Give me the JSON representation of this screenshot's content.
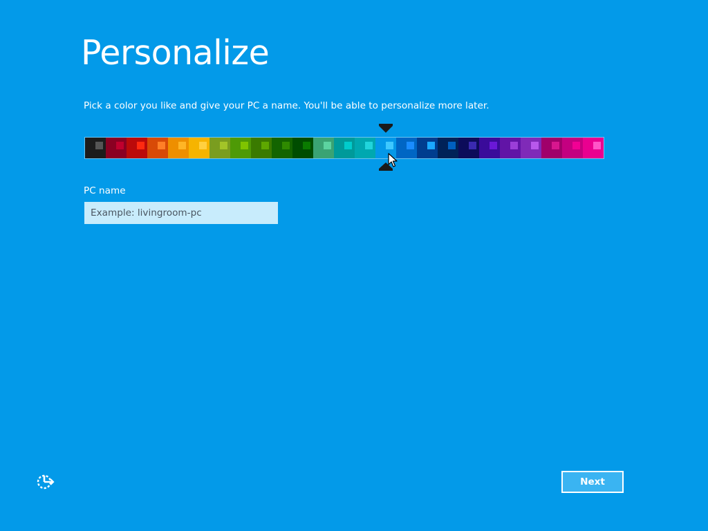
{
  "page": {
    "title": "Personalize",
    "instruction": "Pick a color you like and give your PC a name. You'll be able to personalize more later."
  },
  "colors": {
    "background": "#039ae9",
    "input_bg": "#c8ecfc",
    "button_bg": "#3ab4f2"
  },
  "color_picker": {
    "selected_index": 14,
    "swatches": [
      {
        "bg": "#1c1c1c",
        "accent": "#555555"
      },
      {
        "bg": "#8a0022",
        "accent": "#c0002e"
      },
      {
        "bg": "#bb0a0a",
        "accent": "#ff2a10"
      },
      {
        "bg": "#d84a07",
        "accent": "#ff7f27"
      },
      {
        "bg": "#ee8f00",
        "accent": "#ffb526"
      },
      {
        "bg": "#f6b400",
        "accent": "#ffd040"
      },
      {
        "bg": "#7a9d1f",
        "accent": "#a3c428"
      },
      {
        "bg": "#4e9a06",
        "accent": "#7fc400"
      },
      {
        "bg": "#3a7a00",
        "accent": "#5ea800"
      },
      {
        "bg": "#136400",
        "accent": "#2f8a00"
      },
      {
        "bg": "#004d00",
        "accent": "#0a7a00"
      },
      {
        "bg": "#3aa374",
        "accent": "#5cd3a0"
      },
      {
        "bg": "#009a9a",
        "accent": "#00cccc"
      },
      {
        "bg": "#00a8b0",
        "accent": "#20d4dc"
      },
      {
        "bg": "#0498e8",
        "accent": "#3ec8ff"
      },
      {
        "bg": "#0066c4",
        "accent": "#1a8cff"
      },
      {
        "bg": "#003d8f",
        "accent": "#1aa8ff"
      },
      {
        "bg": "#002258",
        "accent": "#0060c0"
      },
      {
        "bg": "#0c0c5a",
        "accent": "#3a2ab0"
      },
      {
        "bg": "#3a0b9a",
        "accent": "#6a18d8"
      },
      {
        "bg": "#6114a6",
        "accent": "#9b3ed8"
      },
      {
        "bg": "#7f2ab8",
        "accent": "#b858ec"
      },
      {
        "bg": "#a0006a",
        "accent": "#d8168e"
      },
      {
        "bg": "#c40080",
        "accent": "#f20094"
      },
      {
        "bg": "#ea0090",
        "accent": "#ff55c8"
      }
    ]
  },
  "pc_name": {
    "label": "PC name",
    "placeholder": "Example: livingroom-pc",
    "value": ""
  },
  "footer": {
    "ease_of_access_icon": "ease-of-access-icon",
    "next_label": "Next"
  }
}
